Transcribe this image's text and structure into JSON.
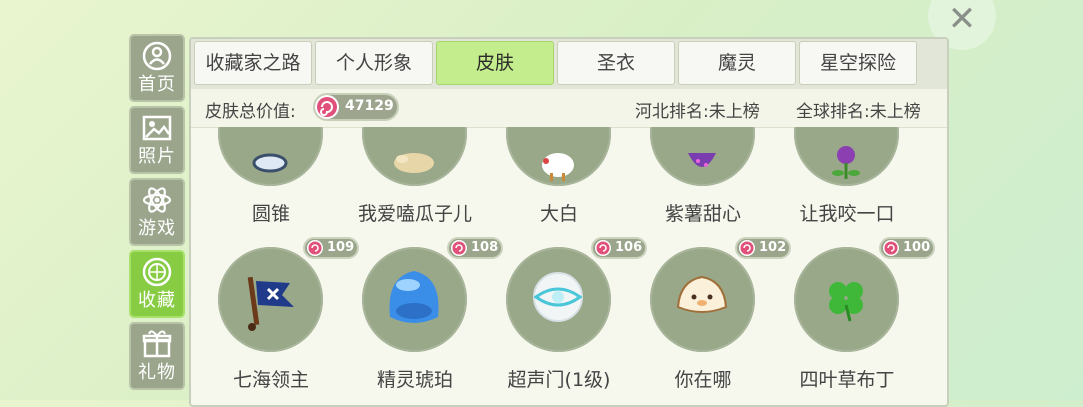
{
  "close_label": "✕",
  "sidebar": {
    "items": [
      {
        "label": "首页",
        "icon": "home-icon"
      },
      {
        "label": "照片",
        "icon": "photo-icon"
      },
      {
        "label": "游戏",
        "icon": "atom-icon"
      },
      {
        "label": "收藏",
        "icon": "collection-icon",
        "active": true
      },
      {
        "label": "礼物",
        "icon": "gift-icon"
      }
    ]
  },
  "tabs": [
    {
      "label": "收藏家之路"
    },
    {
      "label": "个人形象"
    },
    {
      "label": "皮肤",
      "active": true
    },
    {
      "label": "圣衣"
    },
    {
      "label": "魔灵"
    },
    {
      "label": "星空探险"
    }
  ],
  "info": {
    "total_label": "皮肤总价值:",
    "total_value": "47129",
    "region_rank": "河北排名:未上榜",
    "global_rank": "全球排名:未上榜"
  },
  "colors": {
    "active_green": "#88cc44",
    "tab_active": "#c4ee8d",
    "coin_pink": "#e0507a"
  },
  "items_row1": [
    {
      "name": "圆锥",
      "icon": "cone-icon"
    },
    {
      "name": "我爱嗑瓜子儿",
      "icon": "seed-icon"
    },
    {
      "name": "大白",
      "icon": "chicken-icon"
    },
    {
      "name": "紫薯甜心",
      "icon": "purple-potato-icon"
    },
    {
      "name": "让我咬一口",
      "icon": "plant-icon"
    }
  ],
  "items_row2": [
    {
      "name": "七海领主",
      "price": "109",
      "icon": "pirate-flag-icon"
    },
    {
      "name": "精灵琥珀",
      "price": "108",
      "icon": "blue-slime-icon"
    },
    {
      "name": "超声门(1级)",
      "price": "106",
      "icon": "white-sphere-icon"
    },
    {
      "name": "你在哪",
      "price": "102",
      "icon": "dumpling-icon"
    },
    {
      "name": "四叶草布丁",
      "price": "100",
      "icon": "clover-icon"
    }
  ]
}
